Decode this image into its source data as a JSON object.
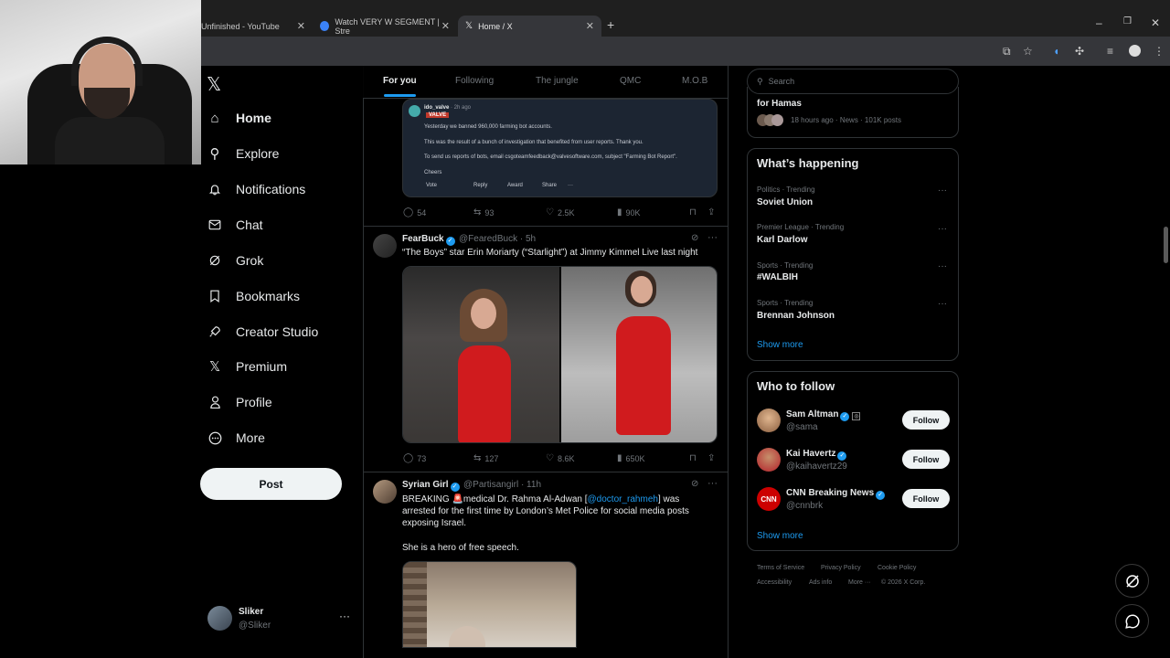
{
  "browser": {
    "tabs": [
      {
        "title": "Unfinished - YouTube",
        "active": false
      },
      {
        "title": "Watch VERY W SEGMENT | Stre",
        "active": false
      },
      {
        "title": "Home / X",
        "active": true
      }
    ],
    "new_tab": "+",
    "window_controls": {
      "minimize": "–",
      "maximize": "❐",
      "close": "✕"
    }
  },
  "nav": {
    "logo": "𝕏",
    "items": [
      {
        "label": "Home",
        "icon": "home-icon",
        "glyph": "⌂"
      },
      {
        "label": "Explore",
        "icon": "search-icon",
        "glyph": "⌕"
      },
      {
        "label": "Notifications",
        "icon": "bell-icon",
        "glyph": "🔔"
      },
      {
        "label": "Chat",
        "icon": "mail-icon",
        "glyph": "✉"
      },
      {
        "label": "Grok",
        "icon": "grok-icon",
        "glyph": "⊘"
      },
      {
        "label": "Bookmarks",
        "icon": "bookmark-icon",
        "glyph": "🔖"
      },
      {
        "label": "Creator Studio",
        "icon": "rocket-icon",
        "glyph": "🚀"
      },
      {
        "label": "Premium",
        "icon": "x-logo-icon",
        "glyph": "𝕏"
      },
      {
        "label": "Profile",
        "icon": "person-icon",
        "glyph": "👤"
      },
      {
        "label": "More",
        "icon": "more-circle-icon",
        "glyph": "⋯"
      }
    ],
    "post_label": "Post",
    "account": {
      "name": "Sliker",
      "handle": "@Sliker",
      "more": "···"
    }
  },
  "feed": {
    "tabs": [
      "For you",
      "Following",
      "The jungle",
      "QMC",
      "M.O.B"
    ],
    "active_tab": "For you",
    "tweets": [
      {
        "card": {
          "user": "ido_valve",
          "time": "· 2h ago",
          "badge": "VALVE",
          "lines": [
            "Yesterday we banned 960,000 farming bot accounts.",
            "This was the result of a bunch of investigation that benefited from user reports. Thank you.",
            "To send us reports of bots, email csgoteamfeedback@valvesoftware.com, subject \"Farming Bot Report\".",
            "Cheers"
          ],
          "actions": [
            "Vote",
            "Reply",
            "Award",
            "Share",
            "···"
          ]
        },
        "stats": {
          "replies": "54",
          "reposts": "93",
          "likes": "2.5K",
          "views": "90K"
        }
      },
      {
        "name": "FearBuck",
        "handle": "@FearedBuck",
        "time": "· 5h",
        "text": "“The Boys” star Erin Moriarty (“Starlight”) at Jimmy Kimmel Live last night",
        "stats": {
          "replies": "73",
          "reposts": "127",
          "likes": "8.6K",
          "views": "650K"
        }
      },
      {
        "name": "Syrian Girl",
        "handle": "@Partisangirl",
        "time": "· 11h",
        "text_a": "BREAKING 🚨medical Dr. Rahma Al-Adwan [",
        "text_link": "@doctor_rahmeh",
        "text_b": "] was arrested for the first time by London’s Met Police for social media posts exposing Israel.",
        "text2": "She is a hero of free speech."
      }
    ]
  },
  "sidebar": {
    "search_placeholder": "Search",
    "top_trend": {
      "title": "for Hamas",
      "meta": "18 hours ago · News · 101K posts"
    },
    "happening_title": "What’s happening",
    "trends": [
      {
        "category": "Politics · Trending",
        "name": "Soviet Union"
      },
      {
        "category": "Premier League · Trending",
        "name": "Karl Darlow"
      },
      {
        "category": "Sports · Trending",
        "name": "#WALBIH"
      },
      {
        "category": "Sports · Trending",
        "name": "Brennan Johnson"
      }
    ],
    "show_more": "Show more",
    "wtf_title": "Who to follow",
    "who_to_follow": [
      {
        "name": "Sam Altman",
        "handle": "@sama",
        "button": "Follow"
      },
      {
        "name": "Kai Havertz",
        "handle": "@kaihavertz29",
        "button": "Follow"
      },
      {
        "name": "CNN Breaking News",
        "handle": "@cnnbrk",
        "button": "Follow"
      }
    ],
    "wtf_show_more": "Show more",
    "footer": [
      "Terms of Service",
      "Privacy Policy",
      "Cookie Policy",
      "Accessibility",
      "Ads info",
      "More ···",
      "© 2026 X Corp."
    ]
  },
  "colors": {
    "accent": "#1d9bf0",
    "background": "#000000",
    "border": "#2f3336"
  }
}
